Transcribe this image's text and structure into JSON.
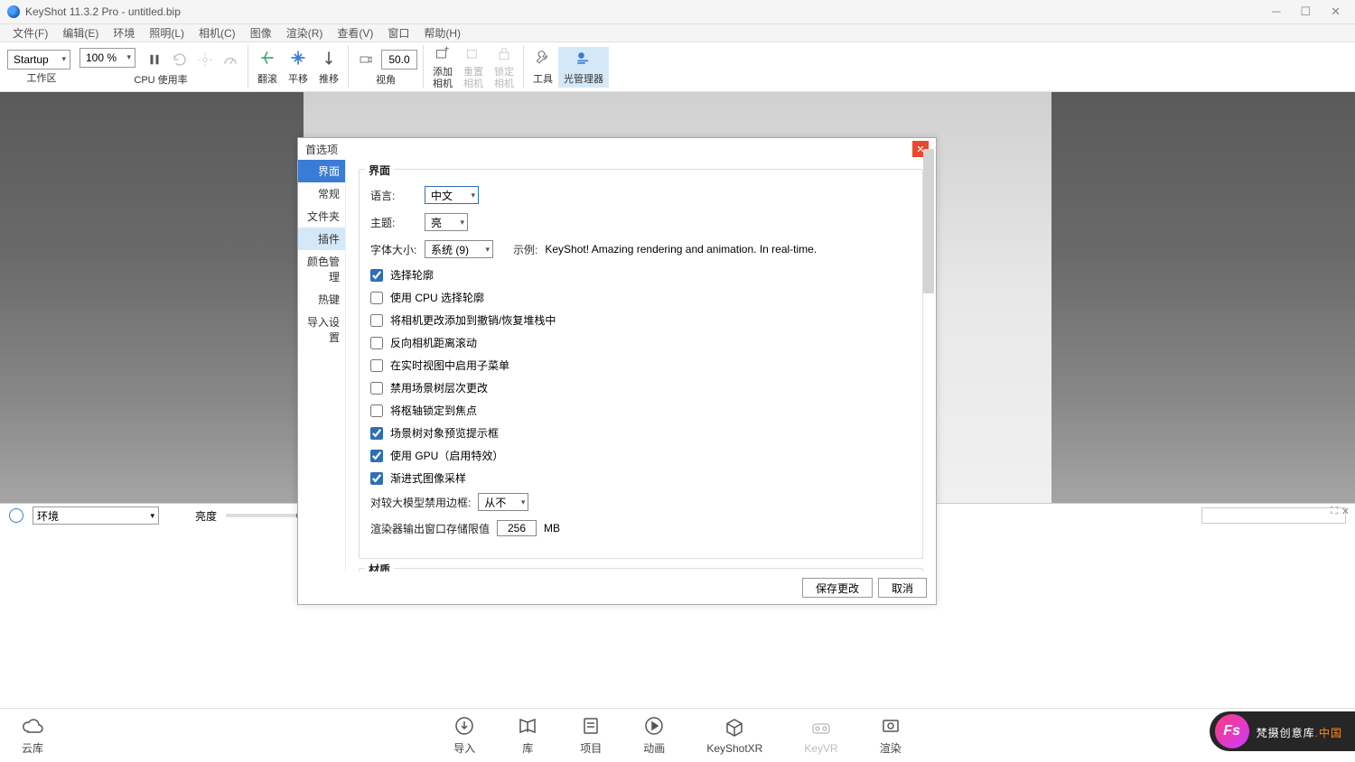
{
  "window": {
    "title": "KeyShot 11.3.2 Pro  - untitled.bip"
  },
  "menu": [
    "文件(F)",
    "编辑(E)",
    "环境",
    "照明(L)",
    "相机(C)",
    "图像",
    "渲染(R)",
    "查看(V)",
    "窗口",
    "帮助(H)"
  ],
  "toolbar": {
    "workspace_dd": "Startup",
    "workspace_label": "工作区",
    "zoom_dd": "100 %",
    "cpu_label": "CPU 使用率",
    "tumble_label": "翻滚",
    "pan_label": "平移",
    "dolly_label": "推移",
    "fov_label": "视角",
    "fov_value": "50.0",
    "add_cam_label": "添加\n相机",
    "reset_cam_label": "重置\n相机",
    "lock_cam_label": "锁定\n相机",
    "tools_label": "工具",
    "light_mgr_label": "光管理器"
  },
  "bottom": {
    "env_select": "环境",
    "brightness_label": "亮度"
  },
  "footer": {
    "cloud": "云库",
    "import": "导入",
    "library": "库",
    "project": "项目",
    "anim": "动画",
    "xr": "KeyShotXR",
    "vr": "KeyVR",
    "render": "渲染"
  },
  "dialog": {
    "title": "首选项",
    "sidebar": [
      "界面",
      "常规",
      "文件夹",
      "插件",
      "颜色管理",
      "热键",
      "导入设置"
    ],
    "section_interface": "界面",
    "lang_label": "语言:",
    "lang_value": "中文",
    "theme_label": "主题:",
    "theme_value": "亮",
    "font_label": "字体大小:",
    "font_value": "系统 (9)",
    "example_label": "示例:",
    "example_text": "KeyShot! Amazing rendering and animation. In real-time.",
    "checks": [
      {
        "label": "选择轮廓",
        "checked": true
      },
      {
        "label": "使用 CPU 选择轮廓",
        "checked": false
      },
      {
        "label": "将相机更改添加到撤销/恢复堆栈中",
        "checked": false
      },
      {
        "label": "反向相机距离滚动",
        "checked": false
      },
      {
        "label": "在实时视图中启用子菜单",
        "checked": false
      },
      {
        "label": "禁用场景树层次更改",
        "checked": false
      },
      {
        "label": "将枢轴锁定到焦点",
        "checked": false
      },
      {
        "label": "场景树对象预览提示框",
        "checked": true
      },
      {
        "label": "使用 GPU（启用特效）",
        "checked": true
      },
      {
        "label": "渐进式图像采样",
        "checked": true
      }
    ],
    "bbox_label": "对较大模型禁用边框:",
    "bbox_value": "从不",
    "renderer_label": "渲染器输出窗口存储限值",
    "renderer_value": "256",
    "renderer_unit": "MB",
    "section_material": "材质",
    "save_btn": "保存更改",
    "cancel_btn": "取消"
  },
  "watermark": {
    "logo": "Fs",
    "text1": "梵摄创意库",
    "text2": ".中国"
  }
}
